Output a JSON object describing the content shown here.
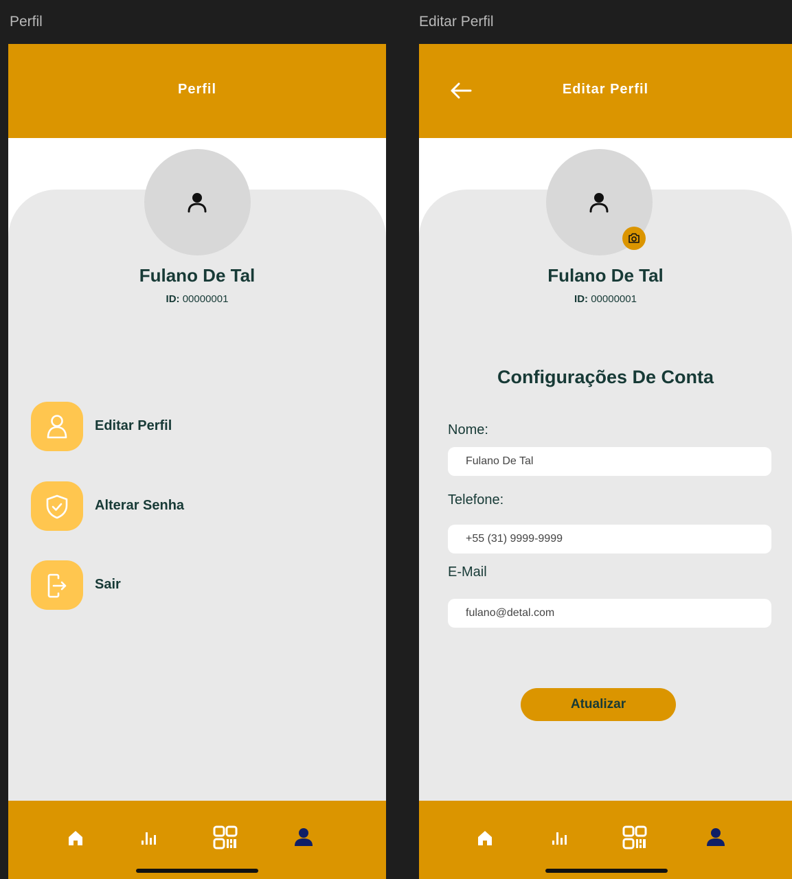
{
  "frames": {
    "left_label": "Perfil",
    "right_label": "Editar Perfil"
  },
  "profile": {
    "header_title": "Perfil",
    "name": "Fulano De Tal",
    "id_label": "ID:",
    "id_value": " 00000001",
    "menu": [
      {
        "label": "Editar Perfil",
        "icon": "user-outline-icon"
      },
      {
        "label": "Alterar Senha",
        "icon": "shield-check-icon"
      },
      {
        "label": "Sair",
        "icon": "logout-icon"
      }
    ]
  },
  "edit": {
    "header_title": "Editar Perfil",
    "name": "Fulano De Tal",
    "id_label": "ID:",
    "id_value": " 00000001",
    "section_title": "Configurações De Conta",
    "fields": [
      {
        "label": "Nome:",
        "value": "Fulano De Tal"
      },
      {
        "label": "Telefone:",
        "value": "+55 (31) 9999-9999"
      },
      {
        "label": "E-Mail",
        "value": "fulano@detal.com"
      }
    ],
    "update_button": "Atualizar"
  },
  "nav": {
    "items": [
      "home-icon",
      "bar-chart-icon",
      "qr-code-icon",
      "person-icon"
    ],
    "active": "person-icon"
  },
  "colors": {
    "accent": "#DB9500",
    "menu_icon_bg": "#FFC64F",
    "text_dark": "#173a36",
    "active_nav": "#0f1f66"
  }
}
